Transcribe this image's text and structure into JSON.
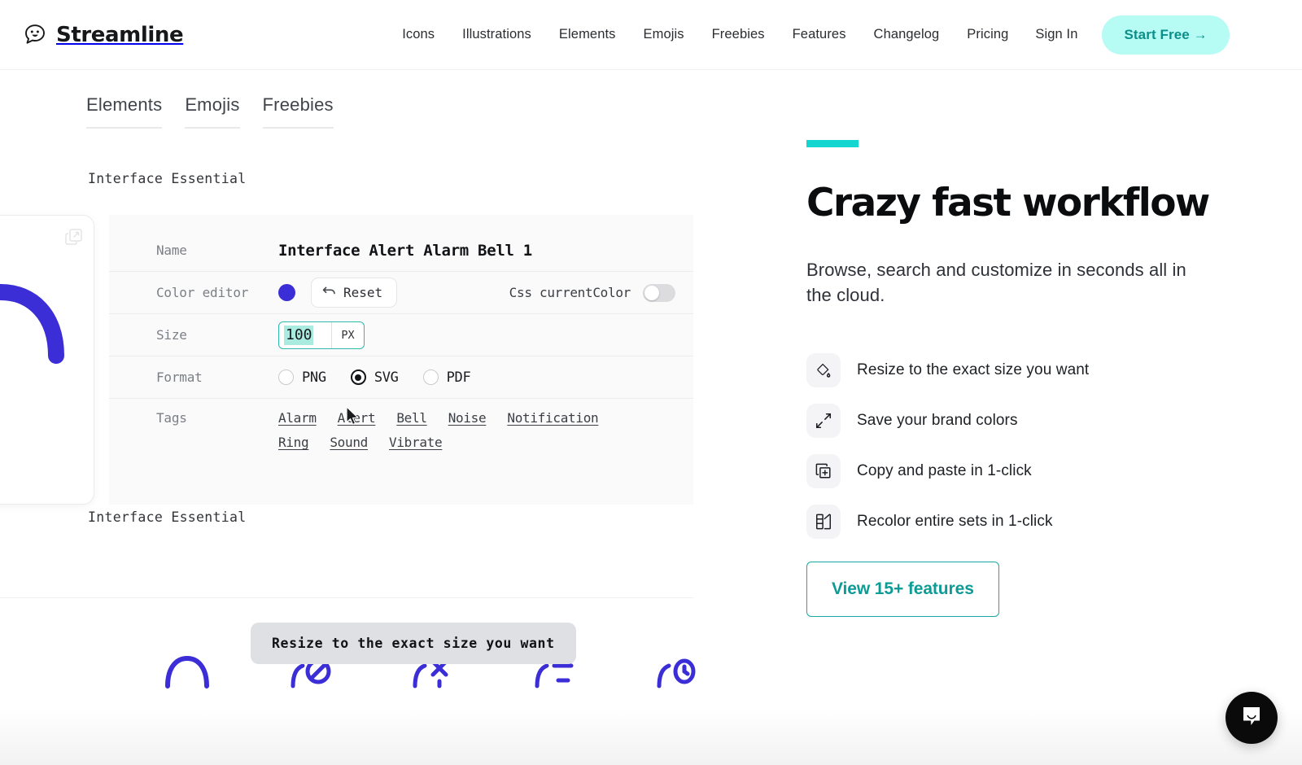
{
  "header": {
    "brand": "Streamline",
    "brand_icon": "speech-bubble-smiley-logo",
    "nav": [
      {
        "label": "Icons"
      },
      {
        "label": "Illustrations"
      },
      {
        "label": "Elements"
      },
      {
        "label": "Emojis"
      },
      {
        "label": "Freebies"
      },
      {
        "label": "Features"
      },
      {
        "label": "Changelog"
      },
      {
        "label": "Pricing"
      },
      {
        "label": "Sign In"
      }
    ],
    "cta": "Start Free →"
  },
  "browser": {
    "tabs": [
      {
        "label": "Elements",
        "partial": true
      },
      {
        "label": "Emojis",
        "partial": false
      },
      {
        "label": "Freebies",
        "partial": false
      }
    ],
    "group_label_top": "Interface Essential",
    "group_label_bottom": "Interface Essential",
    "preview": {
      "open_icon": "external-link-icon",
      "glyph_icon": "alarm-bell-glyph",
      "glyph_color": "#3b2ed6"
    },
    "detail": {
      "name_label": "Name",
      "name_value": "Interface Alert Alarm Bell 1",
      "color_label": "Color editor",
      "color_value": "#3b2ed6",
      "reset_label": "Reset",
      "reset_icon": "undo-arrow-icon",
      "currentcolor_label": "Css currentColor",
      "currentcolor_enabled": false,
      "size_label": "Size",
      "size_value": "100",
      "size_unit": "PX",
      "format_label": "Format",
      "formats": [
        {
          "label": "PNG",
          "selected": false
        },
        {
          "label": "SVG",
          "selected": true
        },
        {
          "label": "PDF",
          "selected": false
        }
      ],
      "tags_label": "Tags",
      "tags": [
        "Alarm",
        "Alert",
        "Bell",
        "Noise",
        "Notification",
        "Ring",
        "Sound",
        "Vibrate"
      ]
    },
    "tooltip": "Resize to the exact size you want",
    "icon_strip": [
      {
        "name": "bell-outline-icon"
      },
      {
        "name": "bell-off-icon"
      },
      {
        "name": "bell-remove-icon"
      },
      {
        "name": "bell-minus-icon"
      },
      {
        "name": "bell-timer-icon"
      }
    ],
    "icon_strip_color": "#3b2ed6"
  },
  "promo": {
    "accent_color": "#14d6d0",
    "title": "Crazy fast workflow",
    "subtitle": "Browse, search and customize in seconds all in the cloud.",
    "features": [
      {
        "icon": "paint-bucket-icon",
        "label": "Resize to the exact size you want"
      },
      {
        "icon": "resize-expand-icon",
        "label": "Save your brand colors"
      },
      {
        "icon": "copy-add-icon",
        "label": "Copy and paste in 1-click"
      },
      {
        "icon": "recolor-palette-icon",
        "label": "Recolor entire sets in 1-click"
      }
    ],
    "button": "View 15+ features"
  },
  "chat": {
    "icon": "chat-bubble-icon"
  }
}
